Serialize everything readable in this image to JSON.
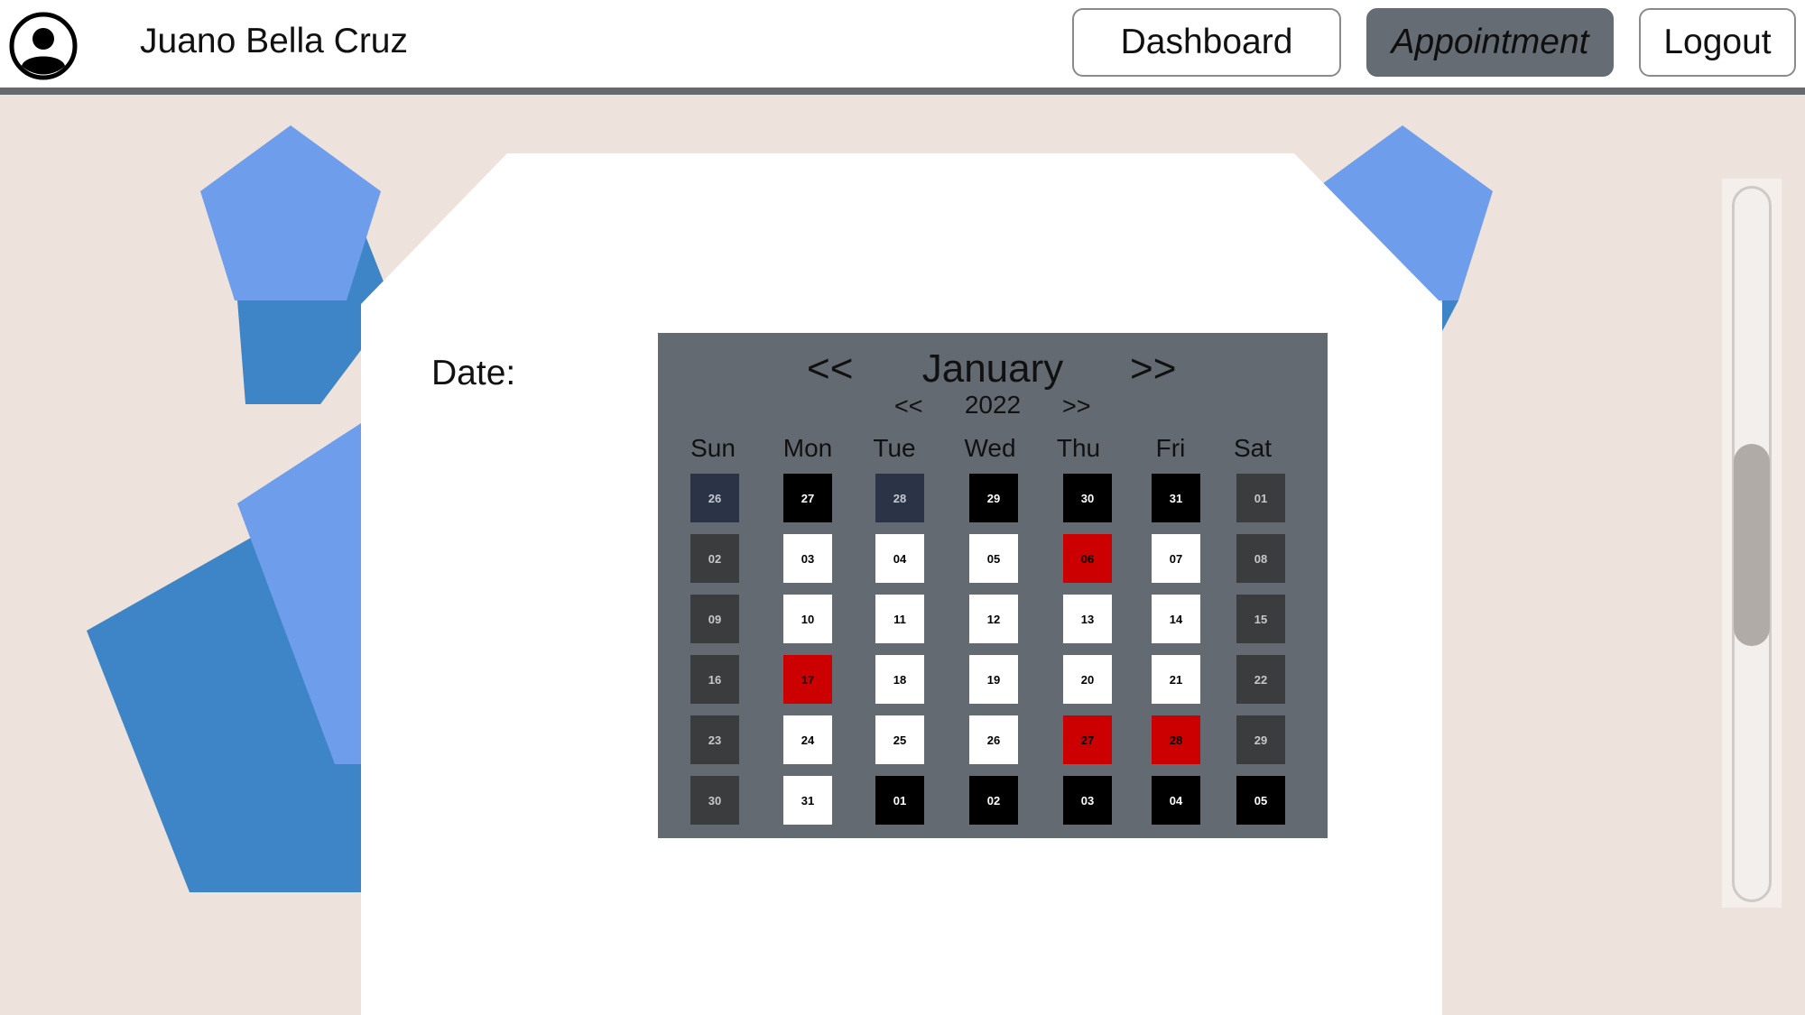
{
  "header": {
    "user_name": "Juano Bella Cruz",
    "nav": {
      "dashboard": "Dashboard",
      "appointment": "Appointment",
      "logout": "Logout"
    },
    "active_tab": "appointment"
  },
  "form": {
    "date_label": "Date:"
  },
  "calendar": {
    "month": "January",
    "year": "2022",
    "prev_month": "<<",
    "next_month": ">>",
    "prev_year": "<<",
    "next_year": ">>",
    "weekdays": [
      "Sun",
      "Mon",
      "Tue",
      "Wed",
      "Thu",
      "Fri",
      "Sat"
    ],
    "weeks": [
      [
        {
          "d": "26",
          "s": "navy"
        },
        {
          "d": "27",
          "s": "black"
        },
        {
          "d": "28",
          "s": "navy"
        },
        {
          "d": "29",
          "s": "black"
        },
        {
          "d": "30",
          "s": "black"
        },
        {
          "d": "31",
          "s": "black"
        },
        {
          "d": "01",
          "s": "weekend"
        }
      ],
      [
        {
          "d": "02",
          "s": "weekend"
        },
        {
          "d": "03",
          "s": "white"
        },
        {
          "d": "04",
          "s": "white"
        },
        {
          "d": "05",
          "s": "white"
        },
        {
          "d": "06",
          "s": "red"
        },
        {
          "d": "07",
          "s": "white"
        },
        {
          "d": "08",
          "s": "weekend"
        }
      ],
      [
        {
          "d": "09",
          "s": "weekend"
        },
        {
          "d": "10",
          "s": "white"
        },
        {
          "d": "11",
          "s": "white"
        },
        {
          "d": "12",
          "s": "white"
        },
        {
          "d": "13",
          "s": "white"
        },
        {
          "d": "14",
          "s": "white"
        },
        {
          "d": "15",
          "s": "weekend"
        }
      ],
      [
        {
          "d": "16",
          "s": "weekend"
        },
        {
          "d": "17",
          "s": "red"
        },
        {
          "d": "18",
          "s": "white"
        },
        {
          "d": "19",
          "s": "white"
        },
        {
          "d": "20",
          "s": "white"
        },
        {
          "d": "21",
          "s": "white"
        },
        {
          "d": "22",
          "s": "weekend"
        }
      ],
      [
        {
          "d": "23",
          "s": "weekend"
        },
        {
          "d": "24",
          "s": "white"
        },
        {
          "d": "25",
          "s": "white"
        },
        {
          "d": "26",
          "s": "white"
        },
        {
          "d": "27",
          "s": "red"
        },
        {
          "d": "28",
          "s": "red"
        },
        {
          "d": "29",
          "s": "weekend"
        }
      ],
      [
        {
          "d": "30",
          "s": "weekend"
        },
        {
          "d": "31",
          "s": "white"
        },
        {
          "d": "01",
          "s": "black"
        },
        {
          "d": "02",
          "s": "black"
        },
        {
          "d": "03",
          "s": "black"
        },
        {
          "d": "04",
          "s": "black"
        },
        {
          "d": "05",
          "s": "black"
        }
      ]
    ]
  },
  "colors": {
    "background": "#ede3dc",
    "header_rule": "#666a6e",
    "active_tab": "#656c74",
    "calendar_bg": "#646a72",
    "shape_light": "#6d9deb",
    "shape_dark": "#3d85c6",
    "booked": "#cc0000",
    "available": "#ffffff",
    "unavailable": "#000000",
    "weekend": "#3b3c3d"
  }
}
